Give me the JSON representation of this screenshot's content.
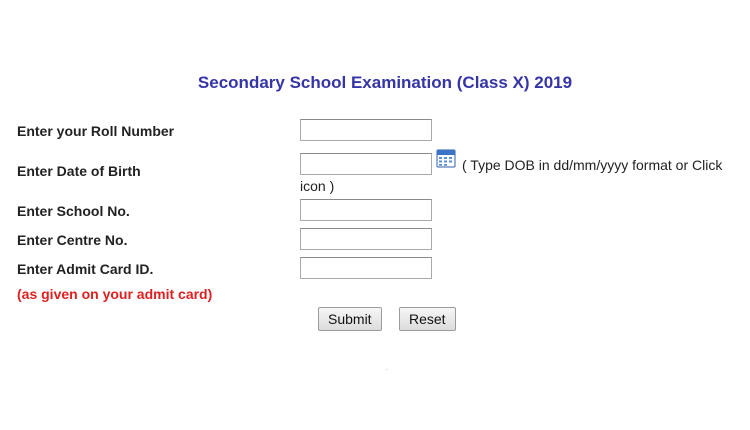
{
  "form": {
    "title": "Secondary School Examination (Class X) 2019",
    "fields": {
      "roll_number": {
        "label": "Enter your Roll Number",
        "value": ""
      },
      "dob": {
        "label": "Enter Date of Birth",
        "value": ""
      },
      "school_no": {
        "label": "Enter School No.",
        "value": ""
      },
      "centre_no": {
        "label": "Enter Centre No.",
        "value": ""
      },
      "admit_card_id": {
        "label": "Enter Admit Card ID.",
        "value": ""
      }
    },
    "dob_hint_line1": "( Type DOB in dd/mm/yyyy format or Click",
    "dob_hint_line2": "icon )",
    "admit_note": "(as given on your admit card)",
    "calendar_icon": "calendar-icon",
    "buttons": {
      "submit": "Submit",
      "reset": "Reset"
    },
    "colors": {
      "title": "#3535a8",
      "note": "#e02020"
    }
  }
}
